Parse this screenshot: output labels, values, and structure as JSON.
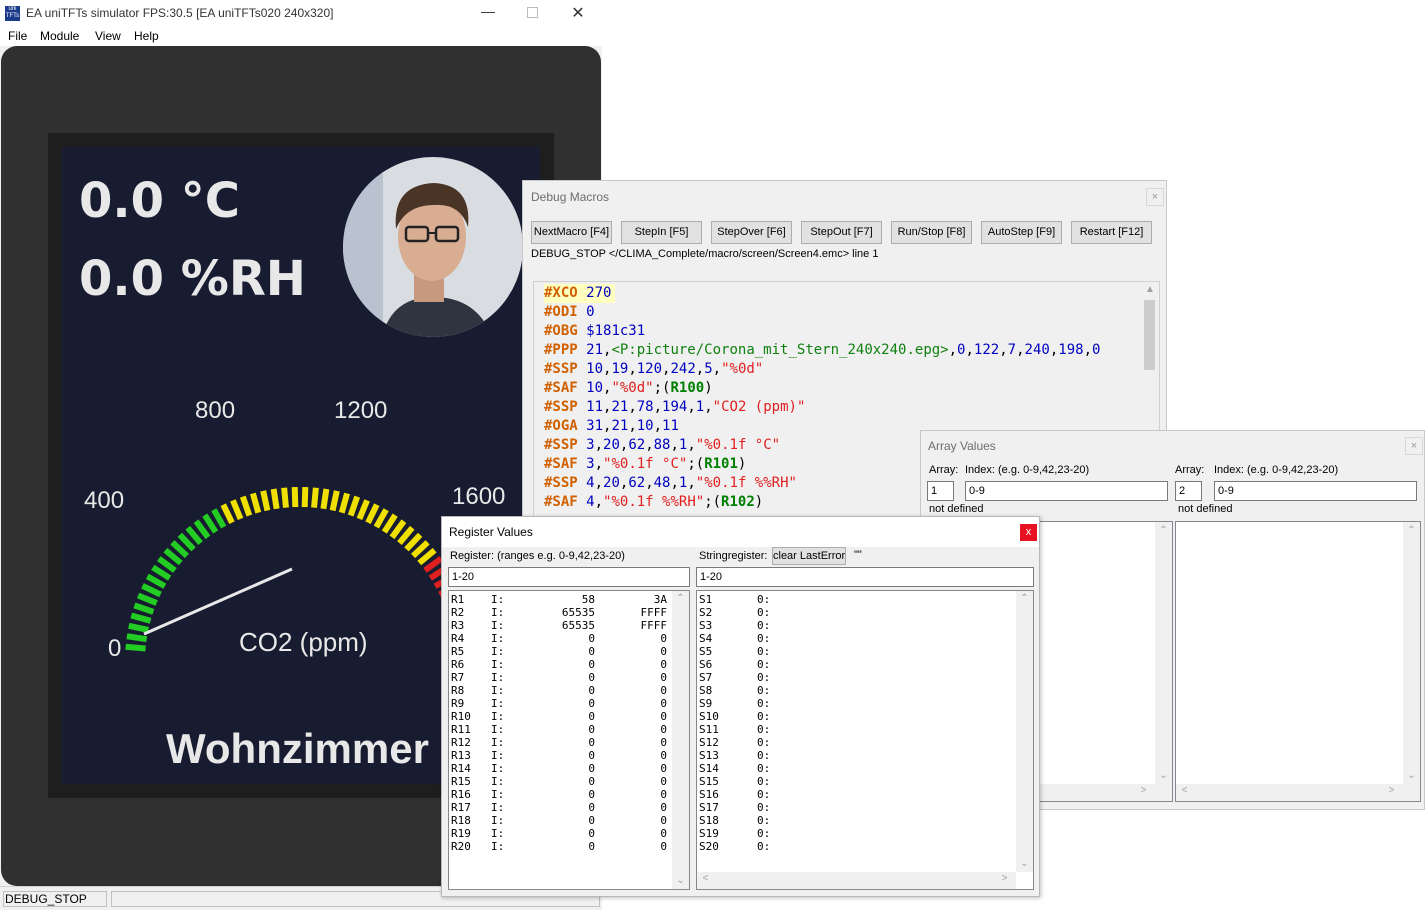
{
  "simulator": {
    "title": "EA uniTFTs simulator FPS:30.5 [EA uniTFTs020 240x320]",
    "logo_text": "uni TFTs",
    "menu": [
      "File",
      "Module",
      "View",
      "Help"
    ],
    "status": "DEBUG_STOP",
    "display": {
      "temperature": "0.0 °C",
      "humidity": "0.0 %RH",
      "gauge_labels": [
        "0",
        "400",
        "800",
        "1200",
        "1600"
      ],
      "gauge_unit": "CO2 (ppm)",
      "room": "Wohnzimmer",
      "colors": {
        "bg": "#181c31",
        "green": "#22cc22",
        "yellow": "#f0e000",
        "red": "#e02020"
      }
    }
  },
  "debug_macros": {
    "title": "Debug Macros",
    "buttons": [
      "NextMacro [F4]",
      "StepIn [F5]",
      "StepOver [F6]",
      "StepOut [F7]",
      "Run/Stop [F8]",
      "AutoStep [F9]",
      "Restart [F12]"
    ],
    "status_line": "DEBUG_STOP </CLIMA_Complete/macro/screen/Screen4.emc> line 1",
    "code": [
      [
        {
          "t": "#XCO",
          "c": "cmd"
        },
        {
          "t": " "
        },
        {
          "t": "270",
          "c": "num"
        }
      ],
      [
        {
          "t": "#ODI",
          "c": "cmd"
        },
        {
          "t": " "
        },
        {
          "t": "0",
          "c": "num"
        }
      ],
      [
        {
          "t": "#OBG",
          "c": "cmd"
        },
        {
          "t": " "
        },
        {
          "t": "$181c31",
          "c": "num"
        }
      ],
      [
        {
          "t": "#PPP",
          "c": "cmd"
        },
        {
          "t": " "
        },
        {
          "t": "21",
          "c": "num"
        },
        {
          "t": ","
        },
        {
          "t": "<P:picture/Corona_mit_Stern_240x240.epg>",
          "c": "path"
        },
        {
          "t": ","
        },
        {
          "t": "0",
          "c": "num"
        },
        {
          "t": ","
        },
        {
          "t": "122",
          "c": "num"
        },
        {
          "t": ","
        },
        {
          "t": "7",
          "c": "num"
        },
        {
          "t": ","
        },
        {
          "t": "240",
          "c": "num"
        },
        {
          "t": ","
        },
        {
          "t": "198",
          "c": "num"
        },
        {
          "t": ","
        },
        {
          "t": "0",
          "c": "num"
        }
      ],
      [
        {
          "t": "#SSP",
          "c": "cmd"
        },
        {
          "t": " "
        },
        {
          "t": "10",
          "c": "num"
        },
        {
          "t": ","
        },
        {
          "t": "19",
          "c": "num"
        },
        {
          "t": ","
        },
        {
          "t": "120",
          "c": "num"
        },
        {
          "t": ","
        },
        {
          "t": "242",
          "c": "num"
        },
        {
          "t": ","
        },
        {
          "t": "5",
          "c": "num"
        },
        {
          "t": ","
        },
        {
          "t": "\"%0d\"",
          "c": "str"
        }
      ],
      [
        {
          "t": "#SAF",
          "c": "cmd"
        },
        {
          "t": " "
        },
        {
          "t": "10",
          "c": "num"
        },
        {
          "t": ","
        },
        {
          "t": "\"%0d\"",
          "c": "str"
        },
        {
          "t": ";("
        },
        {
          "t": "R100",
          "c": "reg"
        },
        {
          "t": ")"
        }
      ],
      [
        {
          "t": "#SSP",
          "c": "cmd"
        },
        {
          "t": " "
        },
        {
          "t": "11",
          "c": "num"
        },
        {
          "t": ","
        },
        {
          "t": "21",
          "c": "num"
        },
        {
          "t": ","
        },
        {
          "t": "78",
          "c": "num"
        },
        {
          "t": ","
        },
        {
          "t": "194",
          "c": "num"
        },
        {
          "t": ","
        },
        {
          "t": "1",
          "c": "num"
        },
        {
          "t": ","
        },
        {
          "t": "\"CO2 (ppm)\"",
          "c": "str"
        }
      ],
      [
        {
          "t": "#OGA",
          "c": "cmd"
        },
        {
          "t": " "
        },
        {
          "t": "31",
          "c": "num"
        },
        {
          "t": ","
        },
        {
          "t": "21",
          "c": "num"
        },
        {
          "t": ","
        },
        {
          "t": "10",
          "c": "num"
        },
        {
          "t": ","
        },
        {
          "t": "11",
          "c": "num"
        }
      ],
      [
        {
          "t": "#SSP",
          "c": "cmd"
        },
        {
          "t": " "
        },
        {
          "t": "3",
          "c": "num"
        },
        {
          "t": ","
        },
        {
          "t": "20",
          "c": "num"
        },
        {
          "t": ","
        },
        {
          "t": "62",
          "c": "num"
        },
        {
          "t": ","
        },
        {
          "t": "88",
          "c": "num"
        },
        {
          "t": ","
        },
        {
          "t": "1",
          "c": "num"
        },
        {
          "t": ","
        },
        {
          "t": "\"%0.1f °C\"",
          "c": "str"
        }
      ],
      [
        {
          "t": "#SAF",
          "c": "cmd"
        },
        {
          "t": " "
        },
        {
          "t": "3",
          "c": "num"
        },
        {
          "t": ","
        },
        {
          "t": "\"%0.1f °C\"",
          "c": "str"
        },
        {
          "t": ";("
        },
        {
          "t": "R101",
          "c": "reg"
        },
        {
          "t": ")"
        }
      ],
      [
        {
          "t": "#SSP",
          "c": "cmd"
        },
        {
          "t": " "
        },
        {
          "t": "4",
          "c": "num"
        },
        {
          "t": ","
        },
        {
          "t": "20",
          "c": "num"
        },
        {
          "t": ","
        },
        {
          "t": "62",
          "c": "num"
        },
        {
          "t": ","
        },
        {
          "t": "48",
          "c": "num"
        },
        {
          "t": ","
        },
        {
          "t": "1",
          "c": "num"
        },
        {
          "t": ","
        },
        {
          "t": "\"%0.1f %%RH\"",
          "c": "str"
        }
      ],
      [
        {
          "t": "#SAF",
          "c": "cmd"
        },
        {
          "t": " "
        },
        {
          "t": "4",
          "c": "num"
        },
        {
          "t": ","
        },
        {
          "t": "\"%0.1f %%RH\"",
          "c": "str"
        },
        {
          "t": ";("
        },
        {
          "t": "R102",
          "c": "reg"
        },
        {
          "t": ")"
        }
      ]
    ],
    "colors": {
      "cmd": "#d06000",
      "num": "#0000c0",
      "str": "#e02020",
      "path": "#108010",
      "reg": "#008000",
      "plain": "#000000",
      "current_line": "#ffffc0"
    }
  },
  "array_values": {
    "title": "Array Values",
    "left": {
      "array_label": "Array:",
      "index_label": "Index: (e.g. 0-9,42,23-20)",
      "array_value": "1",
      "index_value": "0-9",
      "status": "not defined"
    },
    "right": {
      "array_label": "Array:",
      "index_label": "Index: (e.g. 0-9,42,23-20)",
      "array_value": "2",
      "index_value": "0-9",
      "status": "not defined"
    }
  },
  "register_values": {
    "title": "Register Values",
    "close_label": "x",
    "register_label": "Register: (ranges e.g. 0-9,42,23-20)",
    "register_range": "1-20",
    "string_label": "Stringregister:",
    "clear_button": "clear LastError",
    "quote": "\"\"",
    "string_range": "1-20",
    "registers": [
      {
        "name": "R1",
        "type": "I:",
        "dec": "58",
        "hex": "3A"
      },
      {
        "name": "R2",
        "type": "I:",
        "dec": "65535",
        "hex": "FFFF"
      },
      {
        "name": "R3",
        "type": "I:",
        "dec": "65535",
        "hex": "FFFF"
      },
      {
        "name": "R4",
        "type": "I:",
        "dec": "0",
        "hex": "0"
      },
      {
        "name": "R5",
        "type": "I:",
        "dec": "0",
        "hex": "0"
      },
      {
        "name": "R6",
        "type": "I:",
        "dec": "0",
        "hex": "0"
      },
      {
        "name": "R7",
        "type": "I:",
        "dec": "0",
        "hex": "0"
      },
      {
        "name": "R8",
        "type": "I:",
        "dec": "0",
        "hex": "0"
      },
      {
        "name": "R9",
        "type": "I:",
        "dec": "0",
        "hex": "0"
      },
      {
        "name": "R10",
        "type": "I:",
        "dec": "0",
        "hex": "0"
      },
      {
        "name": "R11",
        "type": "I:",
        "dec": "0",
        "hex": "0"
      },
      {
        "name": "R12",
        "type": "I:",
        "dec": "0",
        "hex": "0"
      },
      {
        "name": "R13",
        "type": "I:",
        "dec": "0",
        "hex": "0"
      },
      {
        "name": "R14",
        "type": "I:",
        "dec": "0",
        "hex": "0"
      },
      {
        "name": "R15",
        "type": "I:",
        "dec": "0",
        "hex": "0"
      },
      {
        "name": "R16",
        "type": "I:",
        "dec": "0",
        "hex": "0"
      },
      {
        "name": "R17",
        "type": "I:",
        "dec": "0",
        "hex": "0"
      },
      {
        "name": "R18",
        "type": "I:",
        "dec": "0",
        "hex": "0"
      },
      {
        "name": "R19",
        "type": "I:",
        "dec": "0",
        "hex": "0"
      },
      {
        "name": "R20",
        "type": "I:",
        "dec": "0",
        "hex": "0"
      }
    ],
    "strings": [
      {
        "name": "S1",
        "value": "0:"
      },
      {
        "name": "S2",
        "value": "0:"
      },
      {
        "name": "S3",
        "value": "0:"
      },
      {
        "name": "S4",
        "value": "0:"
      },
      {
        "name": "S5",
        "value": "0:"
      },
      {
        "name": "S6",
        "value": "0:"
      },
      {
        "name": "S7",
        "value": "0:"
      },
      {
        "name": "S8",
        "value": "0:"
      },
      {
        "name": "S9",
        "value": "0:"
      },
      {
        "name": "S10",
        "value": "0:"
      },
      {
        "name": "S11",
        "value": "0:"
      },
      {
        "name": "S12",
        "value": "0:"
      },
      {
        "name": "S13",
        "value": "0:"
      },
      {
        "name": "S14",
        "value": "0:"
      },
      {
        "name": "S15",
        "value": "0:"
      },
      {
        "name": "S16",
        "value": "0:"
      },
      {
        "name": "S17",
        "value": "0:"
      },
      {
        "name": "S18",
        "value": "0:"
      },
      {
        "name": "S19",
        "value": "0:"
      },
      {
        "name": "S20",
        "value": "0:"
      }
    ]
  }
}
